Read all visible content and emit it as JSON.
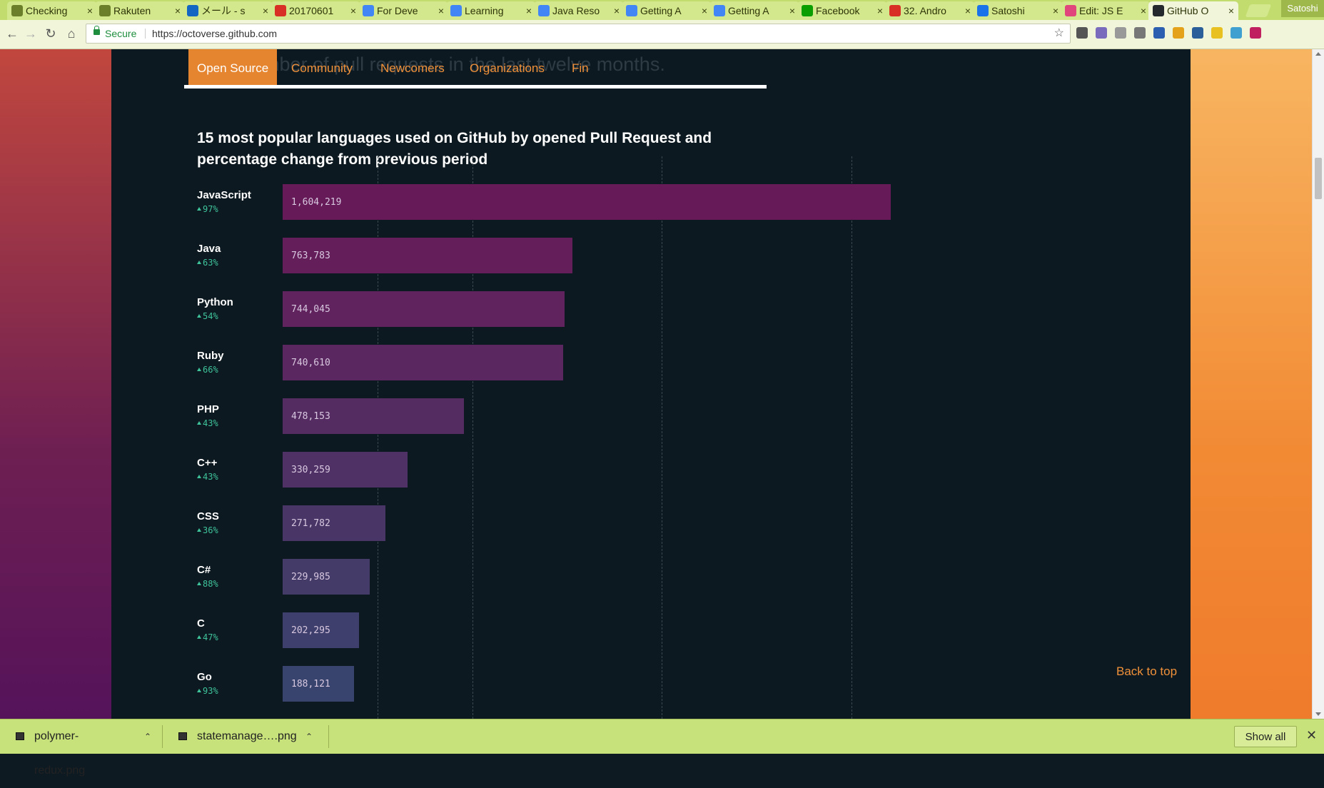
{
  "browser": {
    "tabs": [
      {
        "title": "Checking",
        "favicon": "document-icon",
        "color": "#6b7f2a"
      },
      {
        "title": "Rakuten",
        "favicon": "chat-icon",
        "color": "#6b7f2a"
      },
      {
        "title": "メール - s",
        "favicon": "outlook-icon",
        "color": "#1366c1"
      },
      {
        "title": "20170601",
        "favicon": "error-icon",
        "color": "#d93025"
      },
      {
        "title": "For Deve",
        "favicon": "google-icon",
        "color": "#4285f4"
      },
      {
        "title": "Learning",
        "favicon": "google-icon",
        "color": "#4285f4"
      },
      {
        "title": "Java Reso",
        "favicon": "google-icon",
        "color": "#4285f4"
      },
      {
        "title": "Getting A",
        "favicon": "google-icon",
        "color": "#4285f4"
      },
      {
        "title": "Getting A",
        "favicon": "google-icon",
        "color": "#4285f4"
      },
      {
        "title": "Facebook",
        "favicon": "techcrunch-icon",
        "color": "#0a9e01"
      },
      {
        "title": "32. Andro",
        "favicon": "error-icon",
        "color": "#d93025"
      },
      {
        "title": "Satoshi",
        "favicon": "blog-icon",
        "color": "#1a73e8"
      },
      {
        "title": "Edit: JS E",
        "favicon": "editor-icon",
        "color": "#e0457b"
      },
      {
        "title": "GitHub O",
        "favicon": "github-icon",
        "color": "#24292e"
      }
    ],
    "active_tab_index": 13,
    "profile_name": "Satoshi",
    "secure_label": "Secure",
    "url": "https://octoverse.github.com",
    "extension_icons": [
      "#555555",
      "#7a6bbd",
      "#999999",
      "#777777",
      "#2d5fb0",
      "#e3a21a",
      "#2b5f9a",
      "#e8c020",
      "#40a0d0",
      "#c02060"
    ]
  },
  "page": {
    "ghost_text": "…by number of pull requests in the last twelve months.",
    "subnav": [
      {
        "label": "Open Source",
        "active": true
      },
      {
        "label": "Community",
        "active": false
      },
      {
        "label": "Newcomers",
        "active": false
      },
      {
        "label": "Organizations",
        "active": false
      },
      {
        "label": "Fin",
        "active": false
      }
    ],
    "heading": "15 most popular languages used on GitHub by opened Pull Request and percentage change from previous period",
    "back_to_top": "Back to top"
  },
  "chart_data": {
    "type": "bar",
    "orientation": "horizontal",
    "title": "15 most popular languages used on GitHub by opened Pull Request and percentage change from previous period",
    "categories": [
      "JavaScript",
      "Java",
      "Python",
      "Ruby",
      "PHP",
      "C++",
      "CSS",
      "C#",
      "C",
      "Go"
    ],
    "values": [
      1604219,
      763783,
      744045,
      740610,
      478153,
      330259,
      271782,
      229985,
      202295,
      188121
    ],
    "value_labels": [
      "1,604,219",
      "763,783",
      "744,045",
      "740,610",
      "478,153",
      "330,259",
      "271,782",
      "229,985",
      "202,295",
      "188,121"
    ],
    "changes": [
      "97%",
      "63%",
      "54%",
      "66%",
      "43%",
      "43%",
      "36%",
      "88%",
      "47%",
      "93%"
    ],
    "bar_colors": [
      "#661a58",
      "#641e5a",
      "#60235e",
      "#5b2760",
      "#552c62",
      "#4f3165",
      "#493667",
      "#443b69",
      "#3e3f6c",
      "#39446e"
    ],
    "xlim": [
      0,
      1604219
    ],
    "grid": true
  },
  "downloads": {
    "items": [
      {
        "name": "polymer-redux.png"
      },
      {
        "name": "statemanage….png"
      }
    ],
    "show_all": "Show all"
  }
}
